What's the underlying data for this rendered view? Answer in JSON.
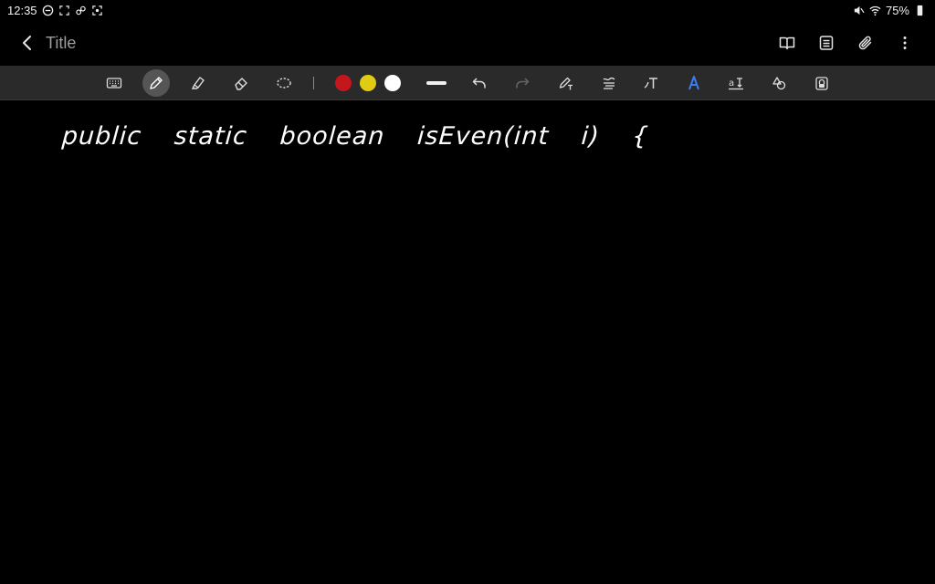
{
  "status": {
    "time": "12:35",
    "battery": "75%"
  },
  "header": {
    "title": "Title"
  },
  "icons": {
    "back": "chevron-left-icon",
    "reading_mode": "book-open-icon",
    "page_list": "list-icon",
    "attach": "paperclip-icon",
    "more": "more-vert-icon",
    "keyboard": "keyboard-icon",
    "pen": "pen-icon",
    "highlighter": "highlighter-icon",
    "eraser": "eraser-icon",
    "lasso": "lasso-icon",
    "undo": "undo-icon",
    "redo": "redo-icon",
    "pen_to_text": "pen-text-icon",
    "straighten": "straighten-icon",
    "text_tool": "text-tool-icon",
    "text_style": "text-style-icon",
    "text_resize": "text-resize-icon",
    "shapes": "shapes-icon",
    "lock": "lock-icon"
  },
  "colors": {
    "red": "#c4161c",
    "yellow": "#e0cc12",
    "white": "#ffffff",
    "toolbar_bg": "#2a2a2a",
    "accent_blue": "#3b7cf5"
  },
  "canvas": {
    "handwritten_text": "public static boolean isEven(int i) {"
  }
}
